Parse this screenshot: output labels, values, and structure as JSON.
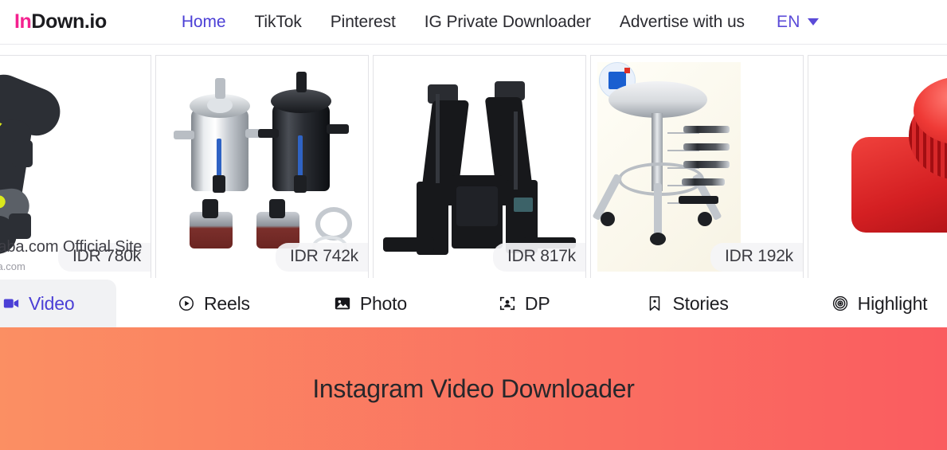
{
  "brand": {
    "logo_prefix": "In",
    "logo_suffix": "Down.io",
    "prefix_color": "#f4218f",
    "suffix_color": "#1b1b1f"
  },
  "nav": {
    "links": [
      {
        "label": "Home",
        "active": true
      },
      {
        "label": "TikTok",
        "active": false
      },
      {
        "label": "Pinterest",
        "active": false
      },
      {
        "label": "IG Private Downloader",
        "active": false
      },
      {
        "label": "Advertise with us",
        "active": false
      }
    ],
    "language": {
      "code": "EN",
      "icon": "chevron-down-icon",
      "color": "#5b4bd8"
    }
  },
  "ad": {
    "products": [
      {
        "name": "dog-harness",
        "price": "IDR 780k"
      },
      {
        "name": "oil-catch-can",
        "price": "IDR 742k"
      },
      {
        "name": "tactical-chest-rig",
        "price": "IDR 817k"
      },
      {
        "name": "lab-stool",
        "price": "IDR 192k"
      },
      {
        "name": "red-siren",
        "price": ""
      }
    ],
    "caption_title": "ibaba.com Official Site",
    "caption_url": "aba.com"
  },
  "tabs": [
    {
      "label": "Video",
      "icon": "video-camera-icon",
      "active": true
    },
    {
      "label": "Reels",
      "icon": "play-circle-icon",
      "active": false
    },
    {
      "label": "Photo",
      "icon": "image-icon",
      "active": false
    },
    {
      "label": "DP",
      "icon": "person-frame-icon",
      "active": false
    },
    {
      "label": "Stories",
      "icon": "bookmark-icon",
      "active": false
    },
    {
      "label": "Highlight",
      "icon": "target-circles-icon",
      "active": false
    }
  ],
  "hero": {
    "title": "Instagram Video Downloader",
    "gradient_start": "#fb8f63",
    "gradient_end": "#fa5c60"
  }
}
